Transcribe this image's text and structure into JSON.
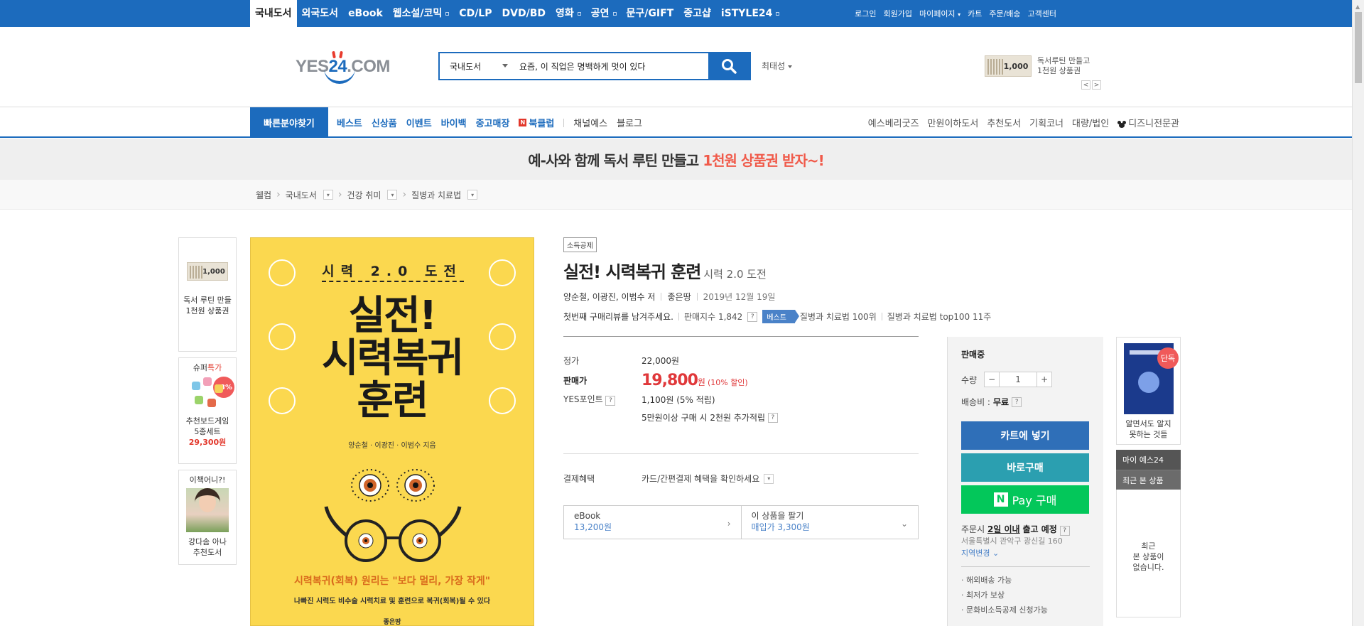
{
  "topnav": {
    "items": [
      {
        "label": "국내도서",
        "active": true
      },
      {
        "label": "외국도서"
      },
      {
        "label": "eBook"
      },
      {
        "label": "웹소설/코믹"
      },
      {
        "label": "CD/LP"
      },
      {
        "label": "DVD/BD"
      },
      {
        "label": "영화"
      },
      {
        "label": "공연"
      },
      {
        "label": "문구/GIFT"
      },
      {
        "label": "중고샵"
      },
      {
        "label": "iSTYLE24"
      }
    ],
    "util": [
      "로그인",
      "회원가입",
      "마이페이지",
      "카트",
      "주문/배송",
      "고객센터"
    ]
  },
  "logo": {
    "text_pre": "YES",
    "text_num": "24",
    "text_post": ".COM"
  },
  "search": {
    "category": "국내도서",
    "value": "요즘, 이 직업은 명백하게 멋이 있다",
    "sort_label": "최태성"
  },
  "promo_top": {
    "voucher": "1,000",
    "line1": "독서루틴 만들고",
    "line2": "1천원 상품권",
    "prev": "<",
    "next": ">"
  },
  "gnb": {
    "quick": "빠른분야찾기",
    "menu_bold": [
      "베스트",
      "신상품",
      "이벤트",
      "바이백",
      "중고매장"
    ],
    "bookclub_badge": "N",
    "bookclub": "북클럽",
    "menu_plain": [
      "채널예스",
      "블로그"
    ],
    "right": [
      "예스베리굿즈",
      "만원이하도서",
      "추천도서",
      "기획코너",
      "대량/법인"
    ],
    "disney": "디즈니전문관"
  },
  "banner": {
    "text": "예-사와 함께 독서 루틴 만들고",
    "highlight": "1천원 상품권 받자~!"
  },
  "breadcrumb": {
    "home": "웰컴",
    "items": [
      "국내도서",
      "건강 취미",
      "질병과 치료법"
    ]
  },
  "left_side": {
    "voucher": "1,000",
    "voucher_text1": "독서 루틴 만들",
    "voucher_text2": "1천원 상품권",
    "deal_prefix": "슈퍼",
    "deal_tag": "특가",
    "deal_badge": "53%",
    "deal_name1": "추천보드게임",
    "deal_name2": "5종세트",
    "deal_price": "29,300원",
    "book_title": "이책어니?!",
    "book_name1": "강다솜 아나",
    "book_name2": "추천도서"
  },
  "cover": {
    "top": "시력 2.0 도전",
    "title1": "실전!",
    "title2": "시력복귀",
    "title3": "훈련",
    "authors": "양순철 · 이광진 · 이범수 지음",
    "tagline": "시력복귀(회복) 원리는 \"보다 멀리, 가장 작게\"",
    "sub": "나빠진 시력도 비수술 시력치료 및 훈련으로 복귀(회복)될 수 있다",
    "publisher": "좋은땅"
  },
  "product": {
    "tax_tag": "소득공제",
    "title": "실전! 시력복귀 훈련",
    "subtitle": "시력 2.0 도전",
    "authors": "양순철, 이광진, 이범수 저",
    "publisher": "좋은땅",
    "date": "2019년 12월 19일",
    "review_prompt": "첫번째 구매리뷰를 남겨주세요.",
    "sales_index": "판매지수 1,842",
    "best_flag": "베스트",
    "rank1": "질병과 치료법 100위",
    "rank2": "질병과 치료법 top100 11주"
  },
  "price": {
    "list_label": "정가",
    "list_price": "22,000원",
    "sale_label": "판매가",
    "sale_price": "19,800",
    "sale_unit": "원",
    "discount": "(10% 할인)",
    "point_label": "YES포인트",
    "point": "1,100원 (5% 적립)",
    "bonus": "5만원이상 구매 시 2천원 추가적립",
    "benefit_label": "결제혜택",
    "benefit": "카드/간편결제 혜택을 확인하세요"
  },
  "ebook": {
    "label": "eBook",
    "price": "13,200원",
    "sell_label": "이 상품을 팔기",
    "sell_price": "매입가 3,300원"
  },
  "buy": {
    "status": "판매중",
    "qty_label": "수량",
    "qty": "1",
    "minus": "−",
    "plus": "+",
    "ship_label": "배송비 :",
    "ship_value": "무료",
    "cart": "카트에 넣기",
    "direct": "바로구매",
    "npay_logo": "N",
    "npay": "Pay 구매",
    "deliv_pre": "주문시",
    "deliv_day": "2일 이내",
    "deliv_post": "출고 예정",
    "address": "서울특별시 관악구 광신길 160",
    "change": "지역변경",
    "perks": [
      "· 해외배송 가능",
      "· 최저가 보상",
      "· 문화비소득공제 신청가능"
    ]
  },
  "right_side": {
    "exclusive": "단독",
    "book_title1": "알면서도 알지",
    "book_title2": "못하는 것들",
    "my": "마이 예스24",
    "recent": "최근 본 상품",
    "empty1": "최근",
    "empty2": "본 상품이",
    "empty3": "없습니다."
  }
}
